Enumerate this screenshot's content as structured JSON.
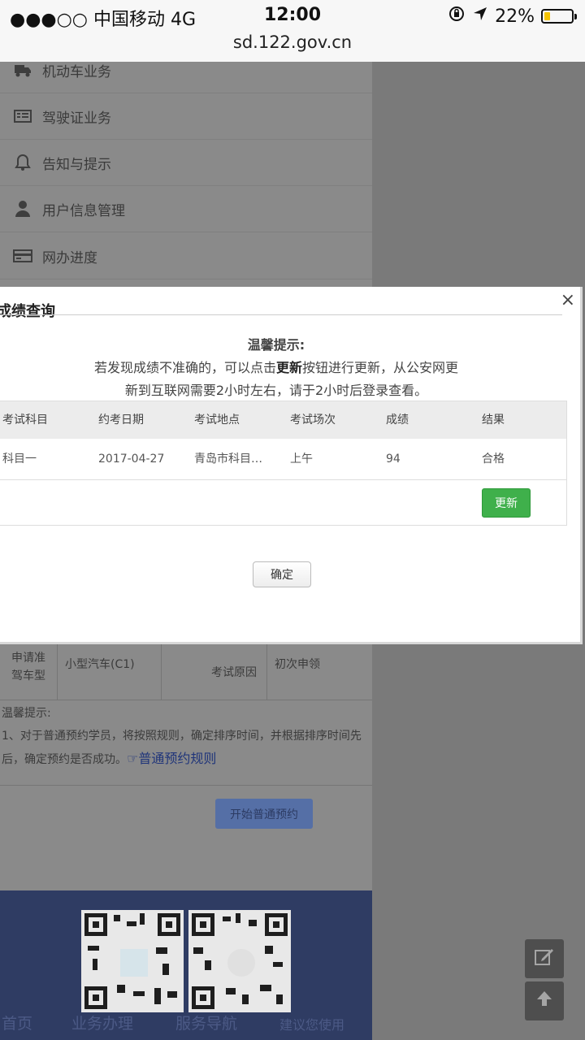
{
  "status_bar": {
    "carrier": "●●●○○ 中国移动   4G",
    "time": "12:00",
    "battery": "22%",
    "battery_level": 0.22,
    "url": "sd.122.gov.cn"
  },
  "menu": [
    {
      "label": "机动车业务",
      "icon": "truck-icon"
    },
    {
      "label": "驾驶证业务",
      "icon": "license-card-icon"
    },
    {
      "label": "告知与提示",
      "icon": "bell-icon"
    },
    {
      "label": "用户信息管理",
      "icon": "user-icon"
    },
    {
      "label": "网办进度",
      "icon": "progress-card-icon"
    }
  ],
  "info_table": {
    "label1": "申请准驾车型",
    "value1": "小型汽车(C1)",
    "label2": "考试原因",
    "value2": "初次申领"
  },
  "tips": {
    "title": "温馨提示:",
    "text": "1、对于普通预约学员，将按照规则，确定排序时间，并根据排序时间先后，确定预约是否成功。",
    "link": "普通预约规则"
  },
  "start_button": "开始普通预约",
  "footer_nav": [
    "首页",
    "业务办理",
    "服务导航",
    "建议您使用"
  ],
  "modal": {
    "title": "成绩查询",
    "close": "×",
    "tip_title": "温馨提示:",
    "tip_line1_pre": "若发现成绩不准确的，可以点击",
    "tip_line1_bold": "更新",
    "tip_line1_post": "按钮进行更新，从公安网更",
    "tip_line2": "新到互联网需要2小时左右，请于2小时后登录查看。",
    "columns": [
      "考试科目",
      "约考日期",
      "考试地点",
      "考试场次",
      "成绩",
      "结果"
    ],
    "row": [
      "科目一",
      "2017-04-27",
      "青岛市科目…",
      "上午",
      "94",
      "合格"
    ],
    "update_button": "更新",
    "ok_button": "确定"
  }
}
